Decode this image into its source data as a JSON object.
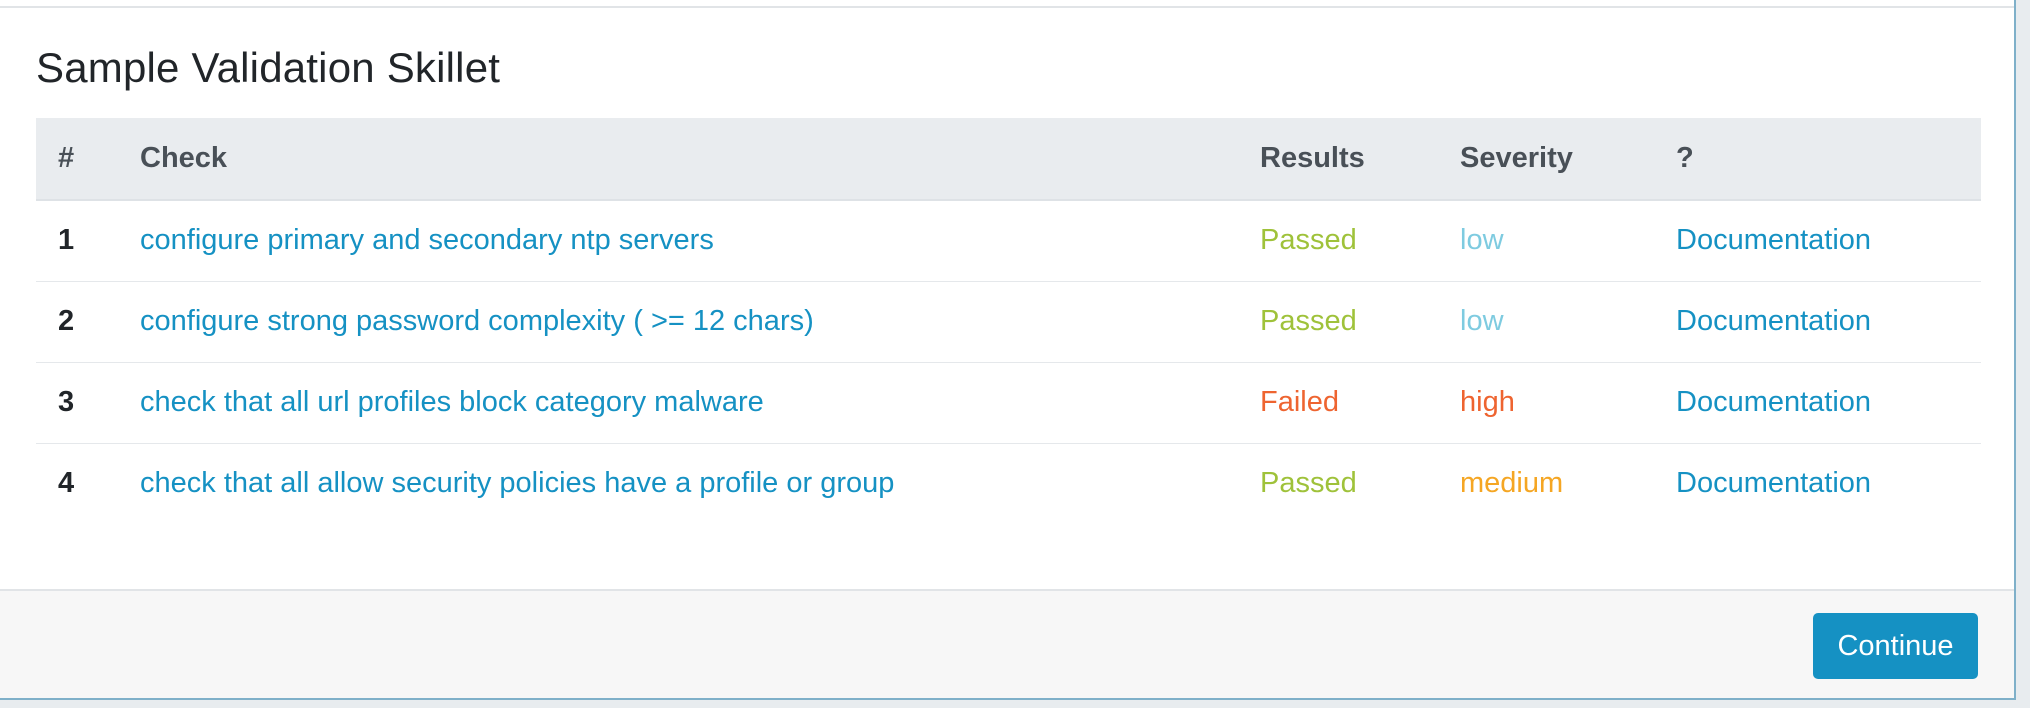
{
  "title": "Sample Validation Skillet",
  "table": {
    "headers": [
      "#",
      "Check",
      "Results",
      "Severity",
      "?"
    ],
    "rows": [
      {
        "num": "1",
        "check": "configure primary and secondary ntp servers",
        "result": "Passed",
        "severity": "low",
        "doc": "Documentation"
      },
      {
        "num": "2",
        "check": "configure strong password complexity ( >= 12 chars)",
        "result": "Passed",
        "severity": "low",
        "doc": "Documentation"
      },
      {
        "num": "3",
        "check": "check that all url profiles block category malware",
        "result": "Failed",
        "severity": "high",
        "doc": "Documentation"
      },
      {
        "num": "4",
        "check": "check that all allow security policies have a profile or group",
        "result": "Passed",
        "severity": "medium",
        "doc": "Documentation"
      }
    ]
  },
  "footer": {
    "continue_label": "Continue"
  },
  "colors": {
    "accent": "#1591c3",
    "passed": "#9fc23a",
    "failed": "#ee6430",
    "severity_low": "#7ecbe0",
    "severity_high": "#ee6430",
    "severity_medium": "#f5a623"
  }
}
